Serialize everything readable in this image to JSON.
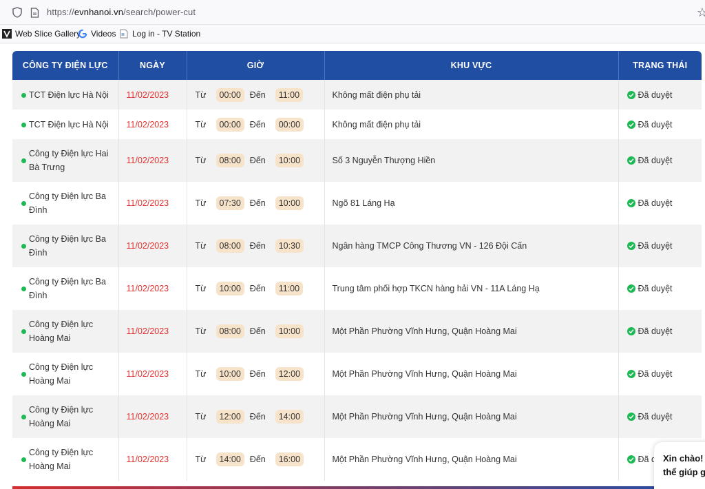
{
  "browser": {
    "url_prefix": "https://",
    "url_host": "evnhanoi.vn",
    "url_path": "/search/power-cut",
    "bookmarks": [
      {
        "label": "Web Slice Gallery",
        "icon": "web-slice-icon"
      },
      {
        "label": "Videos",
        "icon": "google-icon"
      },
      {
        "label": "Log in - TV Station",
        "icon": "page-icon"
      }
    ]
  },
  "table": {
    "headers": {
      "company": "CÔNG TY ĐIỆN LỰC",
      "date": "NGÀY",
      "time": "GIỜ",
      "area": "KHU VỰC",
      "status": "TRẠNG THÁI"
    },
    "from_label": "Từ",
    "to_label": "Đến",
    "rows": [
      {
        "company": "TCT Điện lực Hà Nội",
        "date": "11/02/2023",
        "from": "00:00",
        "to": "11:00",
        "area": "Không mất điện phụ tải",
        "status": "Đã duyệt"
      },
      {
        "company": "TCT Điện lực Hà Nội",
        "date": "11/02/2023",
        "from": "00:00",
        "to": "00:00",
        "area": "Không mất điện phụ tải",
        "status": "Đã duyệt"
      },
      {
        "company": "Công ty Điện lực Hai Bà Trưng",
        "date": "11/02/2023",
        "from": "08:00",
        "to": "10:00",
        "area": "Số 3 Nguyễn Thượng Hiền",
        "status": "Đã duyệt"
      },
      {
        "company": "Công ty Điện lực Ba Đình",
        "date": "11/02/2023",
        "from": "07:30",
        "to": "10:00",
        "area": "Ngõ 81 Láng Hạ",
        "status": "Đã duyệt"
      },
      {
        "company": "Công ty Điện lực Ba Đình",
        "date": "11/02/2023",
        "from": "08:00",
        "to": "10:30",
        "area": "Ngân hàng TMCP Công Thương VN - 126 Đội Cấn",
        "status": "Đã duyệt"
      },
      {
        "company": "Công ty Điện lực Ba Đình",
        "date": "11/02/2023",
        "from": "10:00",
        "to": "11:00",
        "area": "Trung tâm phối hợp TKCN hàng hải VN - 11A Láng Hạ",
        "status": "Đã duyệt"
      },
      {
        "company": "Công ty Điện lực Hoàng Mai",
        "date": "11/02/2023",
        "from": "08:00",
        "to": "10:00",
        "area": "Một Phần Phường Vĩnh Hưng, Quận Hoàng Mai",
        "status": "Đã duyệt"
      },
      {
        "company": "Công ty Điện lực Hoàng Mai",
        "date": "11/02/2023",
        "from": "10:00",
        "to": "12:00",
        "area": "Một Phần Phường Vĩnh Hưng, Quận Hoàng Mai",
        "status": "Đã duyệt"
      },
      {
        "company": "Công ty Điện lực Hoàng Mai",
        "date": "11/02/2023",
        "from": "12:00",
        "to": "14:00",
        "area": "Một Phần Phường Vĩnh Hưng, Quận Hoàng Mai",
        "status": "Đã duyệt"
      },
      {
        "company": "Công ty Điện lực Hoàng Mai",
        "date": "11/02/2023",
        "from": "14:00",
        "to": "16:00",
        "area": "Một Phần Phường Vĩnh Hưng, Quận Hoàng Mai",
        "status": "Đã duyệt"
      }
    ]
  },
  "chat": {
    "line1": "Xin chào!",
    "line2": "thể giúp g"
  },
  "colors": {
    "header_bg": "#1f4ea3",
    "date_text": "#e0312f",
    "status_green": "#1db954",
    "time_chip": "#f7e3c9"
  }
}
